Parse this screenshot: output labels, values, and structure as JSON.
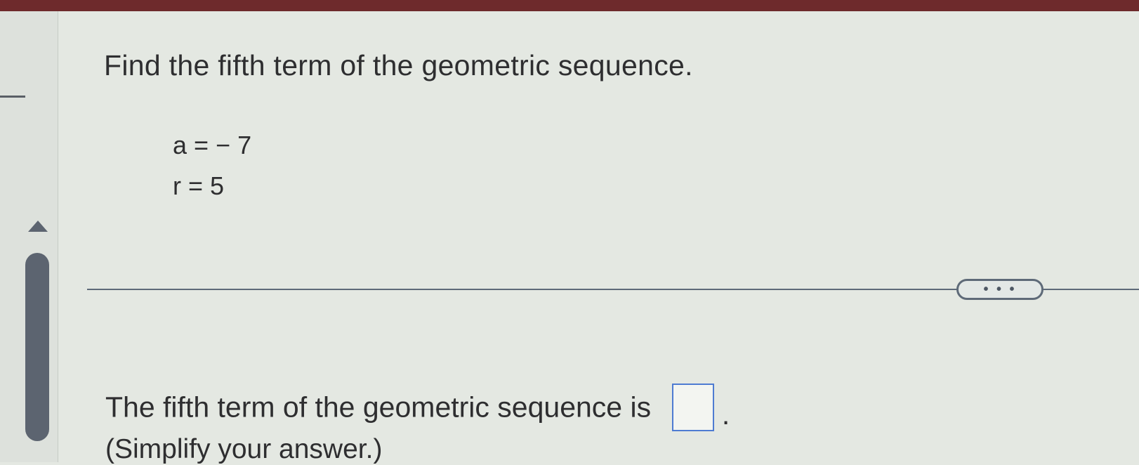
{
  "question": {
    "title": "Find the fifth term of the geometric sequence.",
    "given_a": "a = − 7",
    "given_r": "r = 5"
  },
  "more_button": {
    "label": "• • •"
  },
  "answer": {
    "prompt": "The fifth term of the geometric sequence is",
    "suffix": ".",
    "value": "",
    "hint": "(Simplify your answer.)"
  },
  "colors": {
    "top_bar": "#6e2a2c",
    "answer_box_border": "#4e7bd2",
    "scrollbar": "#5c6470"
  }
}
